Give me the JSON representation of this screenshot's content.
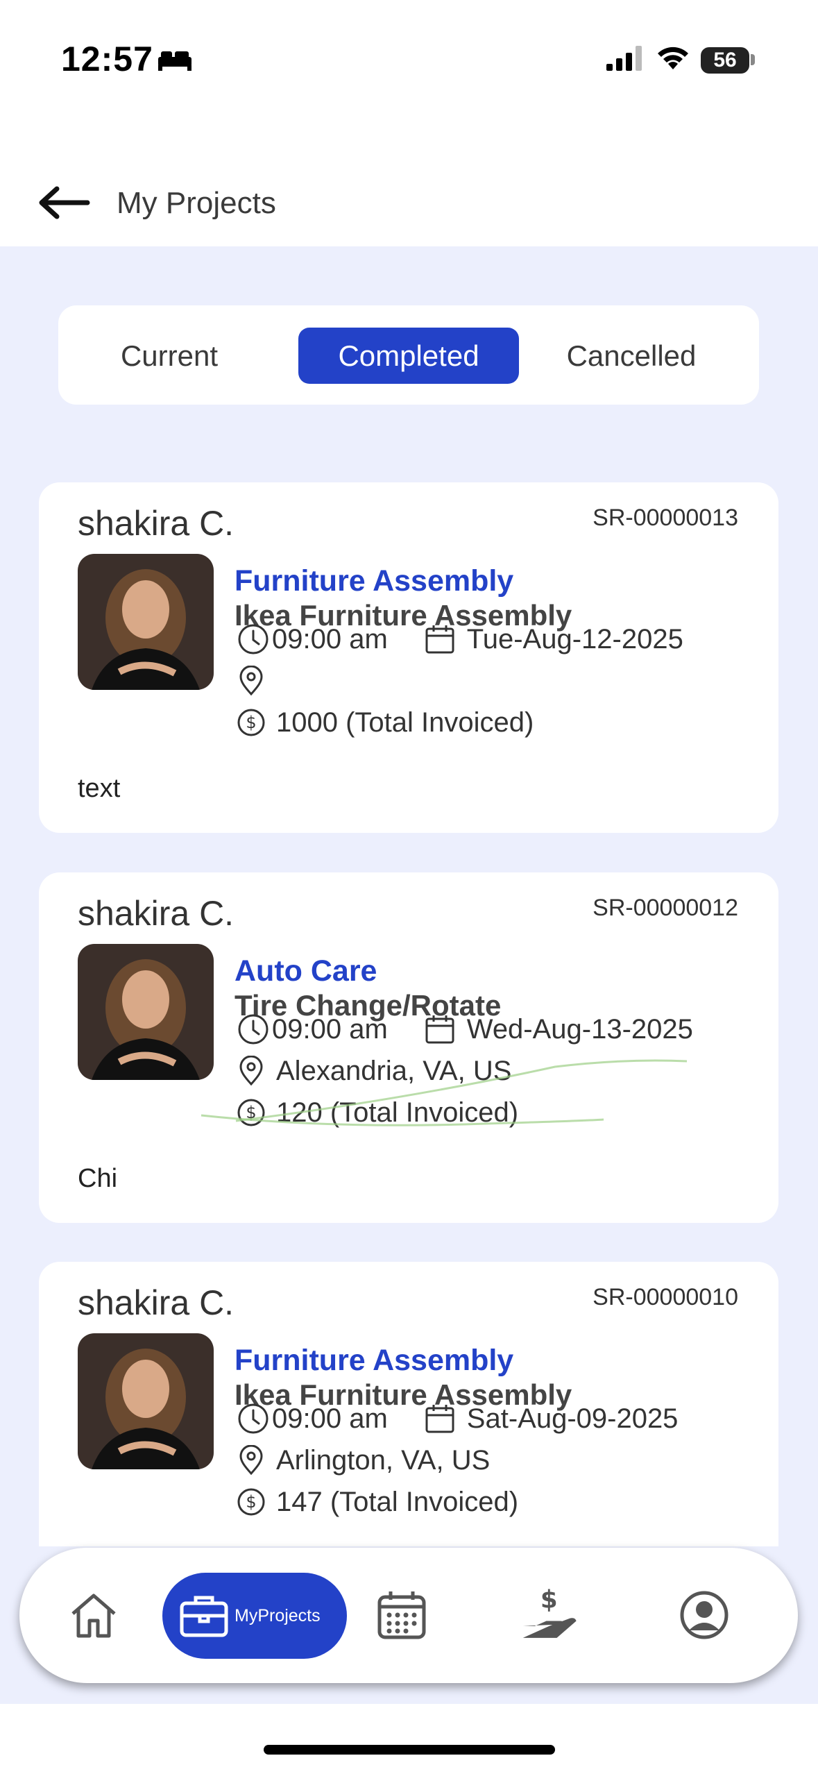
{
  "status_bar": {
    "time": "12:57",
    "battery": "56"
  },
  "header": {
    "title": "My Projects"
  },
  "tabs": [
    {
      "label": "Current",
      "active": false
    },
    {
      "label": "Completed",
      "active": true
    },
    {
      "label": "Cancelled",
      "active": false
    }
  ],
  "projects": [
    {
      "name": "shakira C.",
      "sr": "SR-00000013",
      "category": "Furniture Assembly",
      "service": "Ikea Furniture Assembly",
      "time": "09:00 am",
      "date": "Tue-Aug-12-2025",
      "location": "",
      "amount": "1000 (Total Invoiced)",
      "note": "text"
    },
    {
      "name": "shakira C.",
      "sr": "SR-00000012",
      "category": "Auto Care",
      "service": "Tire Change/Rotate",
      "time": "09:00 am",
      "date": "Wed-Aug-13-2025",
      "location": "Alexandria, VA, US",
      "amount": "120 (Total Invoiced)",
      "note": "Chi"
    },
    {
      "name": "shakira C.",
      "sr": "SR-00000010",
      "category": "Furniture Assembly",
      "service": "Ikea Furniture Assembly",
      "time": "09:00 am",
      "date": "Sat-Aug-09-2025",
      "location": "Arlington, VA, US",
      "amount": "147 (Total Invoiced)",
      "note": ""
    }
  ],
  "bottom_nav": {
    "items": [
      {
        "icon": "home-icon"
      },
      {
        "icon": "briefcase-icon",
        "label": "MyProjects",
        "active": true
      },
      {
        "icon": "calendar-icon"
      },
      {
        "icon": "dollar-hand-icon"
      },
      {
        "icon": "profile-icon"
      }
    ]
  },
  "colors": {
    "accent": "#2342c8",
    "background": "#eceffd"
  }
}
